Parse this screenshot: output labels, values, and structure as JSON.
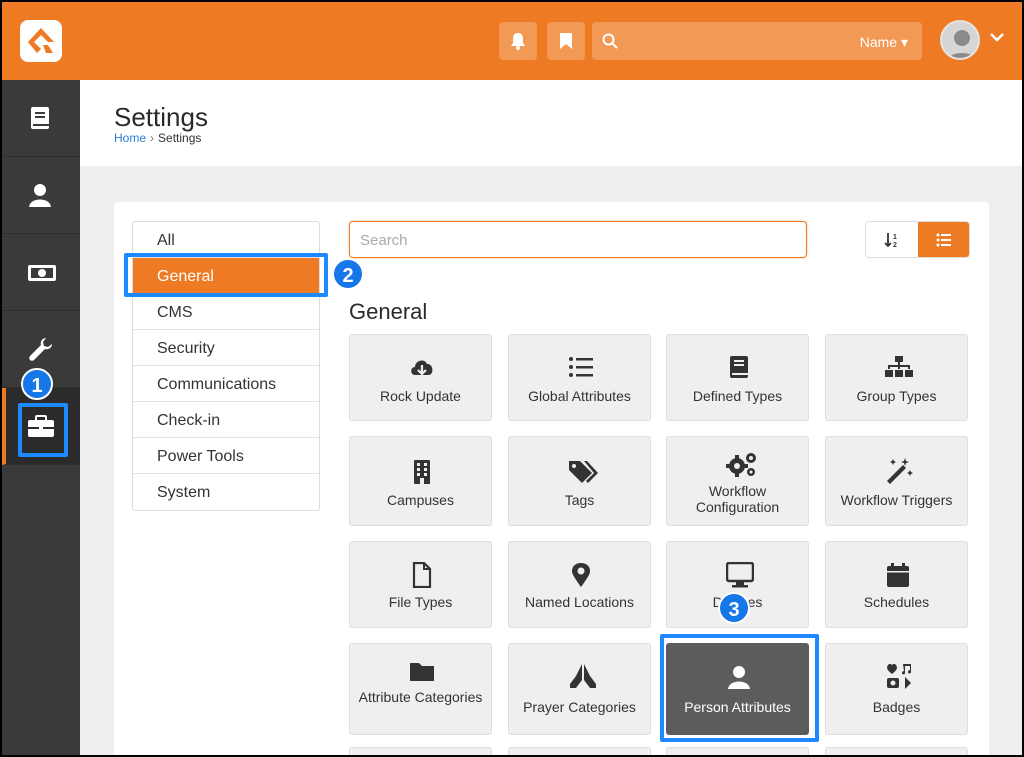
{
  "header": {
    "search_filter_label": "Name ▾",
    "icons": [
      "rock-logo-icon",
      "bell-icon",
      "bookmark-icon",
      "search-icon",
      "avatar-icon",
      "chevron-down-icon"
    ]
  },
  "sidebar": {
    "items": [
      {
        "icon": "book-icon"
      },
      {
        "icon": "person-icon"
      },
      {
        "icon": "money-icon"
      },
      {
        "icon": "wrench-icon"
      },
      {
        "icon": "briefcase-icon",
        "active": true
      }
    ]
  },
  "page": {
    "title": "Settings",
    "breadcrumb": {
      "home": "Home",
      "separator": "›",
      "current": "Settings"
    }
  },
  "categories": {
    "items": [
      {
        "label": "All"
      },
      {
        "label": "General",
        "active": true
      },
      {
        "label": "CMS"
      },
      {
        "label": "Security"
      },
      {
        "label": "Communications"
      },
      {
        "label": "Check-in"
      },
      {
        "label": "Power Tools"
      },
      {
        "label": "System"
      }
    ]
  },
  "search": {
    "placeholder": "Search"
  },
  "section": {
    "title": "General"
  },
  "tiles": [
    {
      "label": "Rock Update",
      "icon": "cloud-download-icon"
    },
    {
      "label": "Global Attributes",
      "icon": "list-icon"
    },
    {
      "label": "Defined Types",
      "icon": "book-icon"
    },
    {
      "label": "Group Types",
      "icon": "sitemap-icon"
    },
    {
      "label": "Campuses",
      "icon": "building-icon"
    },
    {
      "label": "Tags",
      "icon": "tags-icon"
    },
    {
      "label": "Workflow Configuration",
      "icon": "cogs-icon"
    },
    {
      "label": "Workflow Triggers",
      "icon": "magic-wand-icon"
    },
    {
      "label": "File Types",
      "icon": "file-icon"
    },
    {
      "label": "Named Locations",
      "icon": "map-pin-icon"
    },
    {
      "label": "Devices",
      "icon": "desktop-icon"
    },
    {
      "label": "Schedules",
      "icon": "calendar-icon"
    },
    {
      "label": "Attribute Categories",
      "icon": "folder-icon"
    },
    {
      "label": "Prayer Categories",
      "icon": "praying-hands-icon"
    },
    {
      "label": "Person Attributes",
      "icon": "person-icon",
      "highlighted": true
    },
    {
      "label": "Badges",
      "icon": "badges-icon"
    }
  ],
  "callouts": [
    "1",
    "2",
    "3"
  ],
  "colors": {
    "brand_orange": "#ee7b23",
    "sidebar_dark": "#3a3a3a",
    "callout_blue": "#1e88ff",
    "link_blue": "#2a7bd6"
  }
}
